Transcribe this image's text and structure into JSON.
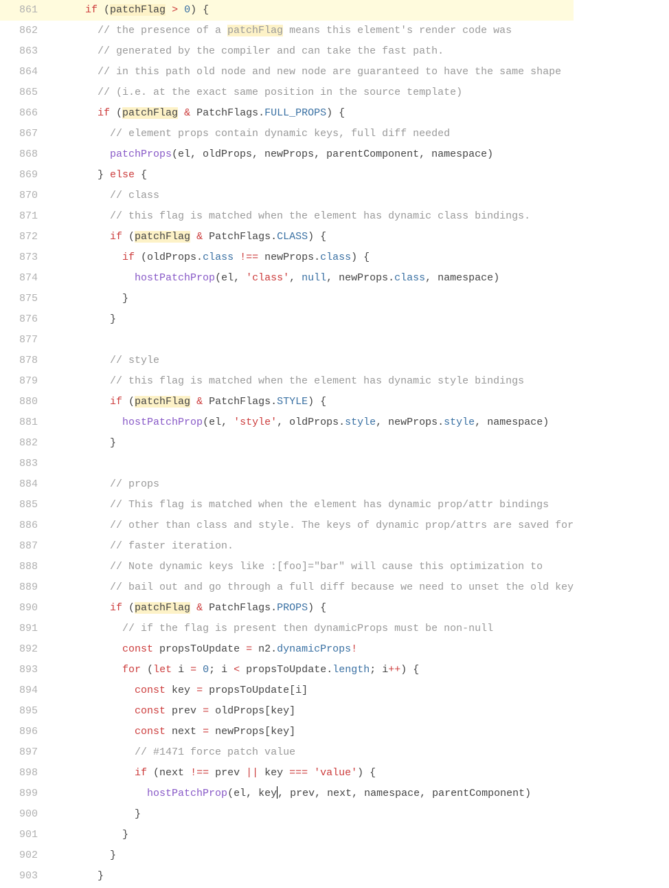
{
  "startLine": 861,
  "highlightedLine": 861,
  "searchTerm": "patchFlag",
  "cursorLine": 899,
  "lines": [
    {
      "indent": 6,
      "tokens": [
        [
          "kw",
          "if"
        ],
        [
          "punct",
          " ("
        ],
        [
          "hl",
          "patchFlag"
        ],
        [
          "punct",
          " "
        ],
        [
          "op",
          ">"
        ],
        [
          "punct",
          " "
        ],
        [
          "num",
          "0"
        ],
        [
          "punct",
          ") {"
        ]
      ]
    },
    {
      "indent": 8,
      "tokens": [
        [
          "com",
          "// the presence of a "
        ],
        [
          "hl com",
          "patchFlag"
        ],
        [
          "com",
          " means this element's render code was"
        ]
      ]
    },
    {
      "indent": 8,
      "tokens": [
        [
          "com",
          "// generated by the compiler and can take the fast path."
        ]
      ]
    },
    {
      "indent": 8,
      "tokens": [
        [
          "com",
          "// in this path old node and new node are guaranteed to have the same shape"
        ]
      ]
    },
    {
      "indent": 8,
      "tokens": [
        [
          "com",
          "// (i.e. at the exact same position in the source template)"
        ]
      ]
    },
    {
      "indent": 8,
      "tokens": [
        [
          "kw",
          "if"
        ],
        [
          "punct",
          " ("
        ],
        [
          "hl",
          "patchFlag"
        ],
        [
          "punct",
          " "
        ],
        [
          "op",
          "&"
        ],
        [
          "punct",
          " PatchFlags."
        ],
        [
          "const",
          "FULL_PROPS"
        ],
        [
          "punct",
          ") {"
        ]
      ]
    },
    {
      "indent": 10,
      "tokens": [
        [
          "com",
          "// element props contain dynamic keys, full diff needed"
        ]
      ]
    },
    {
      "indent": 10,
      "tokens": [
        [
          "fn",
          "patchProps"
        ],
        [
          "punct",
          "(el, oldProps, newProps, parentComponent, namespace)"
        ]
      ]
    },
    {
      "indent": 8,
      "tokens": [
        [
          "punct",
          "} "
        ],
        [
          "kw",
          "else"
        ],
        [
          "punct",
          " {"
        ]
      ]
    },
    {
      "indent": 10,
      "tokens": [
        [
          "com",
          "// class"
        ]
      ]
    },
    {
      "indent": 10,
      "tokens": [
        [
          "com",
          "// this flag is matched when the element has dynamic class bindings."
        ]
      ]
    },
    {
      "indent": 10,
      "tokens": [
        [
          "kw",
          "if"
        ],
        [
          "punct",
          " ("
        ],
        [
          "hl",
          "patchFlag"
        ],
        [
          "punct",
          " "
        ],
        [
          "op",
          "&"
        ],
        [
          "punct",
          " PatchFlags."
        ],
        [
          "const",
          "CLASS"
        ],
        [
          "punct",
          ") {"
        ]
      ]
    },
    {
      "indent": 12,
      "tokens": [
        [
          "kw",
          "if"
        ],
        [
          "punct",
          " (oldProps."
        ],
        [
          "prop",
          "class"
        ],
        [
          "punct",
          " "
        ],
        [
          "op",
          "!=="
        ],
        [
          "punct",
          " newProps."
        ],
        [
          "prop",
          "class"
        ],
        [
          "punct",
          ") {"
        ]
      ]
    },
    {
      "indent": 14,
      "tokens": [
        [
          "fn",
          "hostPatchProp"
        ],
        [
          "punct",
          "(el, "
        ],
        [
          "str",
          "'class'"
        ],
        [
          "punct",
          ", "
        ],
        [
          "const",
          "null"
        ],
        [
          "punct",
          ", newProps."
        ],
        [
          "prop",
          "class"
        ],
        [
          "punct",
          ", namespace)"
        ]
      ]
    },
    {
      "indent": 12,
      "tokens": [
        [
          "punct",
          "}"
        ]
      ]
    },
    {
      "indent": 10,
      "tokens": [
        [
          "punct",
          "}"
        ]
      ]
    },
    {
      "indent": 0,
      "tokens": []
    },
    {
      "indent": 10,
      "tokens": [
        [
          "com",
          "// style"
        ]
      ]
    },
    {
      "indent": 10,
      "tokens": [
        [
          "com",
          "// this flag is matched when the element has dynamic style bindings"
        ]
      ]
    },
    {
      "indent": 10,
      "tokens": [
        [
          "kw",
          "if"
        ],
        [
          "punct",
          " ("
        ],
        [
          "hl",
          "patchFlag"
        ],
        [
          "punct",
          " "
        ],
        [
          "op",
          "&"
        ],
        [
          "punct",
          " PatchFlags."
        ],
        [
          "const",
          "STYLE"
        ],
        [
          "punct",
          ") {"
        ]
      ]
    },
    {
      "indent": 12,
      "tokens": [
        [
          "fn",
          "hostPatchProp"
        ],
        [
          "punct",
          "(el, "
        ],
        [
          "str",
          "'style'"
        ],
        [
          "punct",
          ", oldProps."
        ],
        [
          "prop",
          "style"
        ],
        [
          "punct",
          ", newProps."
        ],
        [
          "prop",
          "style"
        ],
        [
          "punct",
          ", namespace)"
        ]
      ]
    },
    {
      "indent": 10,
      "tokens": [
        [
          "punct",
          "}"
        ]
      ]
    },
    {
      "indent": 0,
      "tokens": []
    },
    {
      "indent": 10,
      "tokens": [
        [
          "com",
          "// props"
        ]
      ]
    },
    {
      "indent": 10,
      "tokens": [
        [
          "com",
          "// This flag is matched when the element has dynamic prop/attr bindings"
        ]
      ]
    },
    {
      "indent": 10,
      "tokens": [
        [
          "com",
          "// other than class and style. The keys of dynamic prop/attrs are saved for"
        ]
      ]
    },
    {
      "indent": 10,
      "tokens": [
        [
          "com",
          "// faster iteration."
        ]
      ]
    },
    {
      "indent": 10,
      "tokens": [
        [
          "com",
          "// Note dynamic keys like :[foo]=\"bar\" will cause this optimization to"
        ]
      ]
    },
    {
      "indent": 10,
      "tokens": [
        [
          "com",
          "// bail out and go through a full diff because we need to unset the old key"
        ]
      ]
    },
    {
      "indent": 10,
      "tokens": [
        [
          "kw",
          "if"
        ],
        [
          "punct",
          " ("
        ],
        [
          "hl",
          "patchFlag"
        ],
        [
          "punct",
          " "
        ],
        [
          "op",
          "&"
        ],
        [
          "punct",
          " PatchFlags."
        ],
        [
          "const",
          "PROPS"
        ],
        [
          "punct",
          ") {"
        ]
      ]
    },
    {
      "indent": 12,
      "tokens": [
        [
          "com",
          "// if the flag is present then dynamicProps must be non-null"
        ]
      ]
    },
    {
      "indent": 12,
      "tokens": [
        [
          "kw",
          "const"
        ],
        [
          "punct",
          " propsToUpdate "
        ],
        [
          "op",
          "="
        ],
        [
          "punct",
          " n2."
        ],
        [
          "prop",
          "dynamicProps"
        ],
        [
          "op",
          "!"
        ]
      ]
    },
    {
      "indent": 12,
      "tokens": [
        [
          "kw",
          "for"
        ],
        [
          "punct",
          " ("
        ],
        [
          "kw",
          "let"
        ],
        [
          "punct",
          " i "
        ],
        [
          "op",
          "="
        ],
        [
          "punct",
          " "
        ],
        [
          "num",
          "0"
        ],
        [
          "punct",
          "; i "
        ],
        [
          "op",
          "<"
        ],
        [
          "punct",
          " propsToUpdate."
        ],
        [
          "prop",
          "length"
        ],
        [
          "punct",
          "; i"
        ],
        [
          "op",
          "++"
        ],
        [
          "punct",
          ") {"
        ]
      ]
    },
    {
      "indent": 14,
      "tokens": [
        [
          "kw",
          "const"
        ],
        [
          "punct",
          " key "
        ],
        [
          "op",
          "="
        ],
        [
          "punct",
          " propsToUpdate[i]"
        ]
      ]
    },
    {
      "indent": 14,
      "tokens": [
        [
          "kw",
          "const"
        ],
        [
          "punct",
          " prev "
        ],
        [
          "op",
          "="
        ],
        [
          "punct",
          " oldProps[key]"
        ]
      ]
    },
    {
      "indent": 14,
      "tokens": [
        [
          "kw",
          "const"
        ],
        [
          "punct",
          " next "
        ],
        [
          "op",
          "="
        ],
        [
          "punct",
          " newProps[key]"
        ]
      ]
    },
    {
      "indent": 14,
      "tokens": [
        [
          "com",
          "// #1471 force patch value"
        ]
      ]
    },
    {
      "indent": 14,
      "tokens": [
        [
          "kw",
          "if"
        ],
        [
          "punct",
          " (next "
        ],
        [
          "op",
          "!=="
        ],
        [
          "punct",
          " prev "
        ],
        [
          "op",
          "||"
        ],
        [
          "punct",
          " key "
        ],
        [
          "op",
          "==="
        ],
        [
          "punct",
          " "
        ],
        [
          "str",
          "'value'"
        ],
        [
          "punct",
          ") {"
        ]
      ]
    },
    {
      "indent": 16,
      "tokens": [
        [
          "fn",
          "hostPatchProp"
        ],
        [
          "punct",
          "(el, key"
        ],
        [
          "cursor",
          ""
        ],
        [
          "punct",
          ", prev, next, namespace, parentComponent)"
        ]
      ]
    },
    {
      "indent": 14,
      "tokens": [
        [
          "punct",
          "}"
        ]
      ]
    },
    {
      "indent": 12,
      "tokens": [
        [
          "punct",
          "}"
        ]
      ]
    },
    {
      "indent": 10,
      "tokens": [
        [
          "punct",
          "}"
        ]
      ]
    },
    {
      "indent": 8,
      "tokens": [
        [
          "punct",
          "}"
        ]
      ]
    }
  ]
}
